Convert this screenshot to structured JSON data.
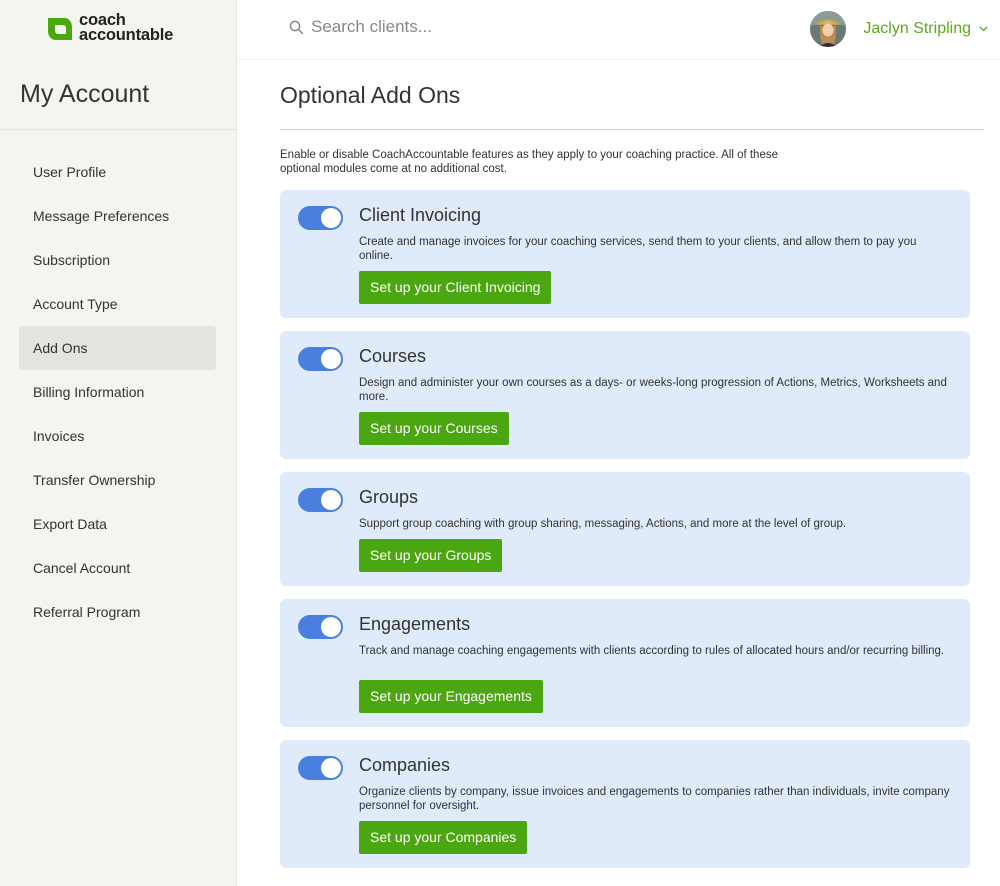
{
  "brand": {
    "line1": "coach",
    "line2": "accountable",
    "color": "#4aa70f"
  },
  "sidebar": {
    "title": "My Account",
    "items": [
      {
        "label": "User Profile",
        "active": false
      },
      {
        "label": "Message Preferences",
        "active": false
      },
      {
        "label": "Subscription",
        "active": false
      },
      {
        "label": "Account Type",
        "active": false
      },
      {
        "label": "Add Ons",
        "active": true
      },
      {
        "label": "Billing Information",
        "active": false
      },
      {
        "label": "Invoices",
        "active": false
      },
      {
        "label": "Transfer Ownership",
        "active": false
      },
      {
        "label": "Export Data",
        "active": false
      },
      {
        "label": "Cancel Account",
        "active": false
      },
      {
        "label": "Referral Program",
        "active": false
      }
    ]
  },
  "header": {
    "search": {
      "placeholder": "Search clients...",
      "value": ""
    },
    "user": {
      "name": "Jaclyn Stripling"
    }
  },
  "main": {
    "title": "Optional Add Ons",
    "intro": "Enable or disable CoachAccountable features as they apply to your coaching practice. All of these optional modules come at no additional cost.",
    "addons": [
      {
        "name": "Client Invoicing",
        "enabled": true,
        "description": "Create and manage invoices for your coaching services, send them to your clients, and allow them to pay you online.",
        "button": "Set up your Client Invoicing"
      },
      {
        "name": "Courses",
        "enabled": true,
        "description": "Design and administer your own courses as a days- or weeks-long progression of Actions, Metrics, Worksheets and more.",
        "button": "Set up your Courses"
      },
      {
        "name": "Groups",
        "enabled": true,
        "description": "Support group coaching with group sharing, messaging, Actions, and more at the level of group.",
        "button": "Set up your Groups"
      },
      {
        "name": "Engagements",
        "enabled": true,
        "description": "Track and manage coaching engagements with clients according to rules of allocated hours and/or recurring billing.",
        "button": "Set up your Engagements"
      },
      {
        "name": "Companies",
        "enabled": true,
        "description": "Organize clients by company, issue invoices and engagements to companies rather than individuals, invite company personnel for oversight.",
        "button": "Set up your Companies"
      }
    ]
  },
  "colors": {
    "toggle_on": "#4a7fe0",
    "button": "#4aa70f",
    "card_bg": "#dfeafa",
    "user_name": "#5aab1a"
  }
}
